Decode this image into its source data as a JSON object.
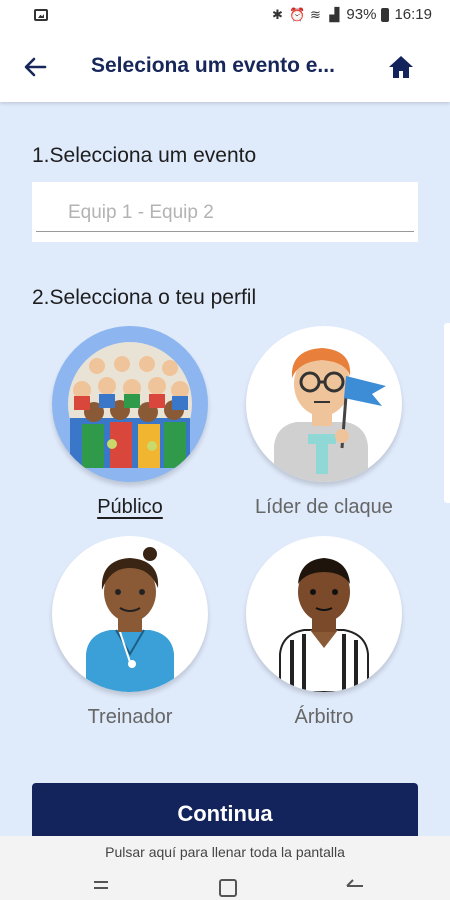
{
  "status_bar": {
    "battery": "93%",
    "time": "16:19"
  },
  "header": {
    "title": "Seleciona um evento e..."
  },
  "event_section": {
    "label": "1.Selecciona um evento",
    "placeholder": "Equip 1 - Equip 2"
  },
  "profile_section": {
    "label": "2.Selecciona o teu perfil",
    "profiles": [
      {
        "label": "Público"
      },
      {
        "label": "Líder de claque"
      },
      {
        "label": "Treinador"
      },
      {
        "label": "Árbitro"
      }
    ]
  },
  "continue_button": {
    "label": "Continua"
  },
  "fullscreen_hint": "Pulsar aquí para llenar toda la pantalla",
  "colors": {
    "primary": "#13235b",
    "background": "#dfeafb",
    "selected": "#8db6f0"
  }
}
